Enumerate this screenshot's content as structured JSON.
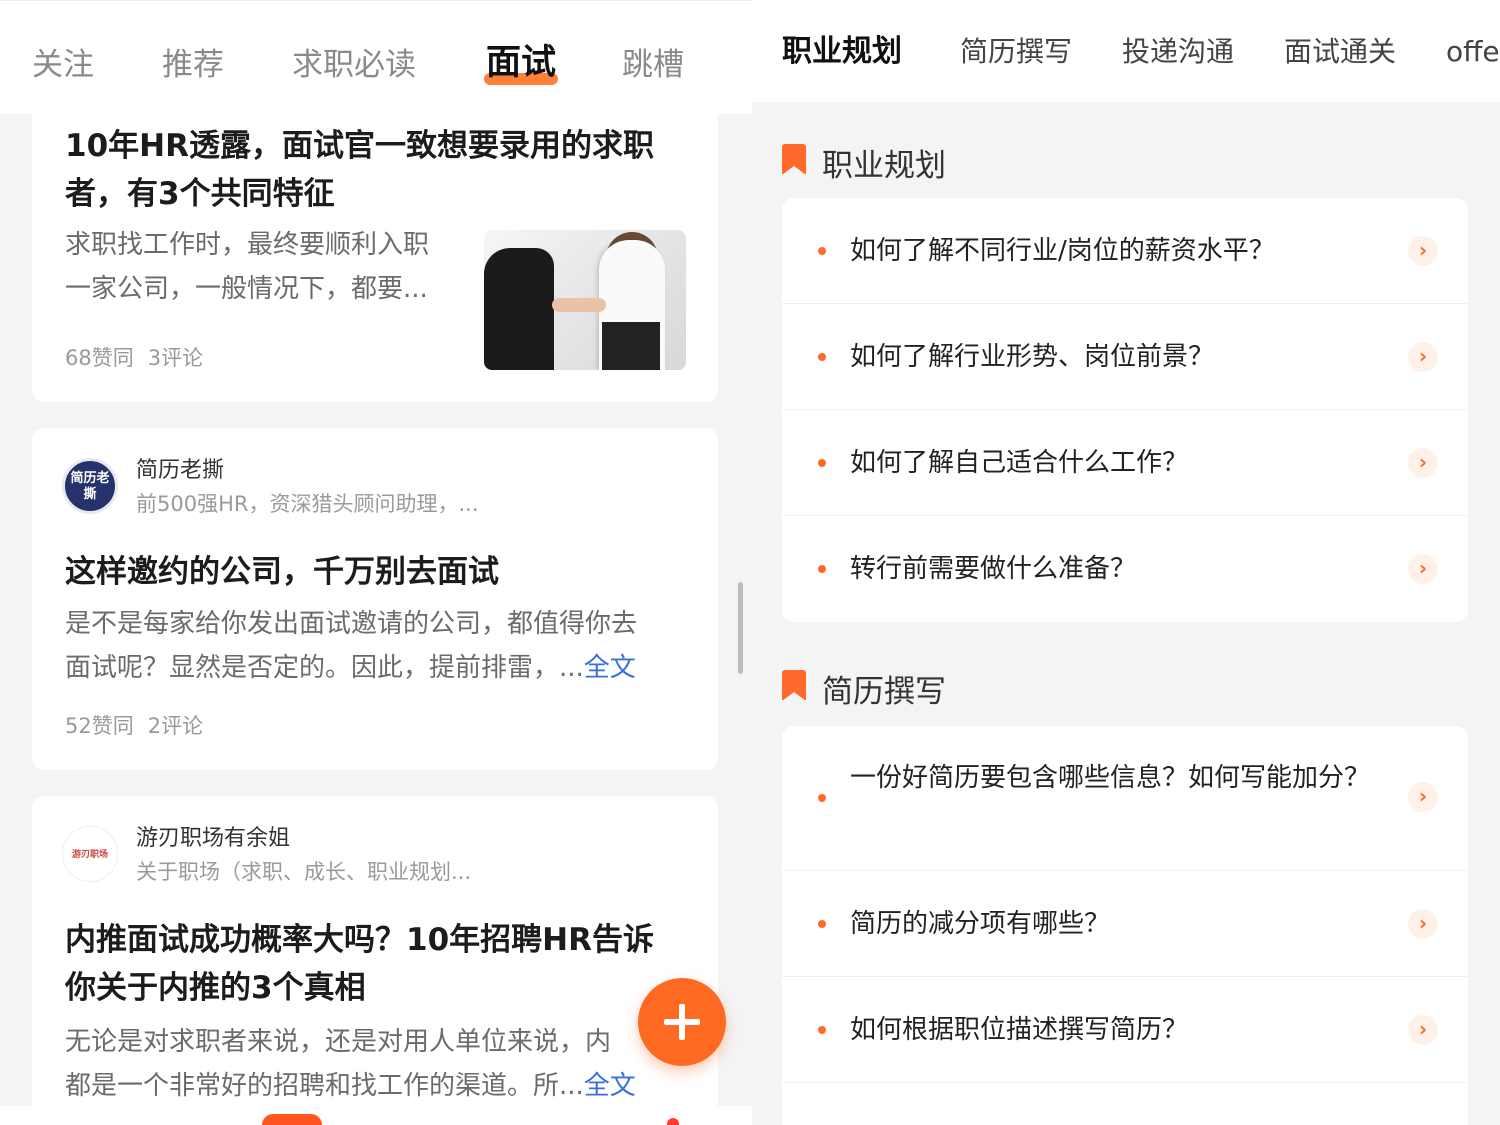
{
  "left": {
    "tabs": [
      "关注",
      "推荐",
      "求职必读",
      "面试",
      "跳槽"
    ],
    "active_tab": "面试",
    "articles": [
      {
        "title_line1": "10年HR透露，面试官一致想要录用的求职",
        "title_line2": "者，有3个共同特征",
        "excerpt_line1": "求职找工作时，最终要顺利入职",
        "excerpt_line2": "一家公司，一般情况下，都要...",
        "likes": "68赞同",
        "comments": "3评论"
      },
      {
        "author": "简历老撕",
        "avatar_text": "简历老撕",
        "bio": "前500强HR，资深猎头顾问助理，...",
        "title": "这样邀约的公司，千万别去面试",
        "excerpt_line1": "是不是每家给你发出面试邀请的公司，都值得你去",
        "excerpt_line2": "面试呢？显然是否定的。因此，提前排雷，...",
        "more": "全文",
        "likes": "52赞同",
        "comments": "2评论"
      },
      {
        "author": "游刃职场有余姐",
        "avatar_text": "游刃职场",
        "bio": "关于职场（求职、成长、职业规划...",
        "title_line1": "内推面试成功概率大吗？10年招聘HR告诉",
        "title_line2": "你关于内推的3个真相",
        "excerpt_line1": "无论是对求职者来说，还是对用人单位来说，内",
        "excerpt_line2": "都是一个非常好的招聘和找工作的渠道。所...",
        "more": "全文"
      }
    ]
  },
  "right": {
    "tabs": [
      "职业规划",
      "简历撰写",
      "投递沟通",
      "面试通关",
      "offe"
    ],
    "active_tab": "职业规划",
    "sections": [
      {
        "title": "职业规划",
        "items": [
          "如何了解不同行业/岗位的薪资水平？",
          "如何了解行业形势、岗位前景？",
          "如何了解自己适合什么工作？",
          "转行前需要做什么准备？"
        ]
      },
      {
        "title": "简历撰写",
        "items": [
          "一份好简历要包含哪些信息？如何写能加分？",
          "简历的减分项有哪些？",
          "如何根据职位描述撰写简历？"
        ]
      }
    ]
  },
  "icons": {
    "fab": "plus-icon",
    "arrow": "chevron-right-icon",
    "bookmark": "bookmark-icon"
  },
  "colors": {
    "accent": "#ff6a23",
    "link": "#3a6fd8"
  }
}
